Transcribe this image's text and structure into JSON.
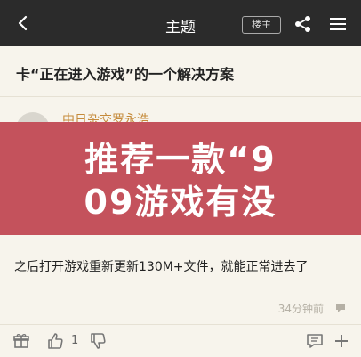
{
  "topbar": {
    "title": "主题",
    "badge": "楼主"
  },
  "post": {
    "title": "卡“正在进入游戏”的一个解决方案"
  },
  "author": {
    "name": "中日杂交罗永浩"
  },
  "overlay": {
    "line1": "推荐一款“9",
    "line2": "09游戏有没"
  },
  "reply": {
    "text": "之后打开游戏重新更新130M+文件，就能正常进去了",
    "time": "34分钟前"
  },
  "bottombar": {
    "like_count": "1"
  },
  "colors": {
    "topbar": "#2b2b2b",
    "background": "#f7f4ec",
    "overlay": "#c4525c",
    "author_name": "#c58a3a"
  }
}
